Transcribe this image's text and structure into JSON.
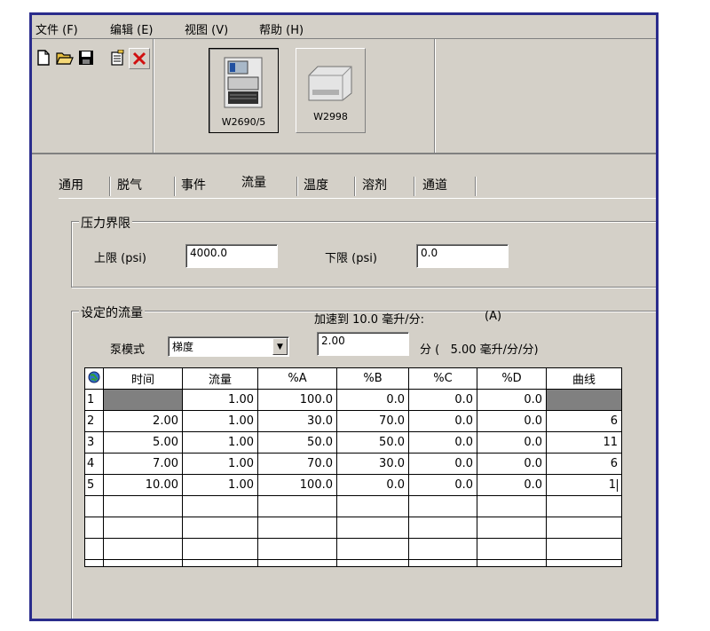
{
  "menu": {
    "items": [
      "文件 (F)",
      "编辑 (E)",
      "视图 (V)",
      "帮助 (H)"
    ]
  },
  "toolbar": {
    "buttons": [
      "new-icon",
      "open-icon",
      "save-icon",
      "properties-icon",
      "delete-icon"
    ]
  },
  "modules": [
    {
      "label": "W2690/5",
      "selected": true
    },
    {
      "label": "W2998",
      "selected": false
    }
  ],
  "tabs": [
    "通用",
    "脱气",
    "事件",
    "流量",
    "温度",
    "溶剂",
    "通道"
  ],
  "active_tab": "流量",
  "pressure": {
    "title": "压力界限",
    "upper_label": "上限 (psi)",
    "upper_value": "4000.0",
    "lower_label": "下限 (psi)",
    "lower_value": "0.0"
  },
  "flow": {
    "title": "设定的流量",
    "accel_label": "加速到 10.0 毫升/分:",
    "accel_key": "(A)",
    "pump_mode_label": "泵模式",
    "pump_mode_value": "梯度",
    "ramp_value": "2.00",
    "ramp_suffix": "分 (   5.00 毫升/分/分)"
  },
  "table": {
    "headers": [
      "",
      "时间",
      "流量",
      "%A",
      "%B",
      "%C",
      "%D",
      "曲线"
    ],
    "rows": [
      [
        "1",
        "",
        "1.00",
        "100.0",
        "0.0",
        "0.0",
        "0.0",
        ""
      ],
      [
        "2",
        "2.00",
        "1.00",
        "30.0",
        "70.0",
        "0.0",
        "0.0",
        "6"
      ],
      [
        "3",
        "5.00",
        "1.00",
        "50.0",
        "50.0",
        "0.0",
        "0.0",
        "11"
      ],
      [
        "4",
        "7.00",
        "1.00",
        "70.0",
        "30.0",
        "0.0",
        "0.0",
        "6"
      ],
      [
        "5",
        "10.00",
        "1.00",
        "100.0",
        "0.0",
        "0.0",
        "0.0",
        "1"
      ]
    ],
    "empty_rows": 4
  },
  "colors": {
    "window_border": "#2a2c8c",
    "face": "#d4d0c8",
    "disabled_cell": "#808080"
  }
}
